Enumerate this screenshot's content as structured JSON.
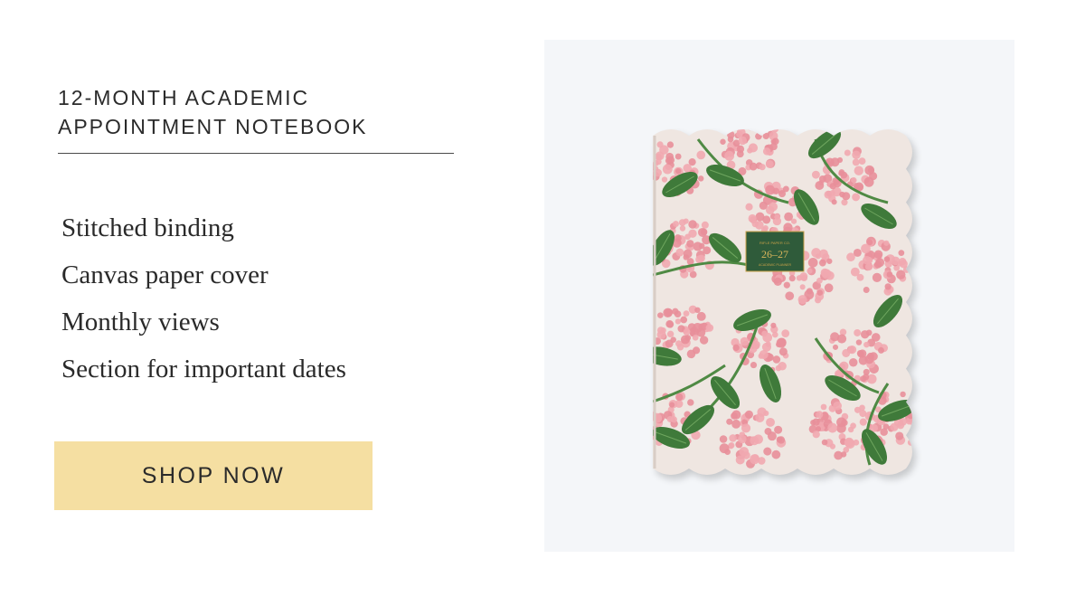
{
  "product": {
    "title_lines": [
      "12-MONTH ACADEMIC",
      "APPOINTMENT NOTEBOOK"
    ],
    "features": [
      "Stitched binding",
      "Canvas paper cover",
      "Monthly views",
      "Section for important dates"
    ],
    "cta_label": "SHOP NOW"
  },
  "image": {
    "description_icon": "notebook-photo",
    "cover_label": {
      "brand": "RIFLE PAPER CO.",
      "years": "26–27",
      "subtitle": "ACADEMIC PLANNER"
    }
  },
  "colors": {
    "cta_background": "#f5dfa2",
    "photo_background": "#f4f6f9",
    "label_green": "#2f5b3a",
    "label_gold": "#c9a24a"
  }
}
